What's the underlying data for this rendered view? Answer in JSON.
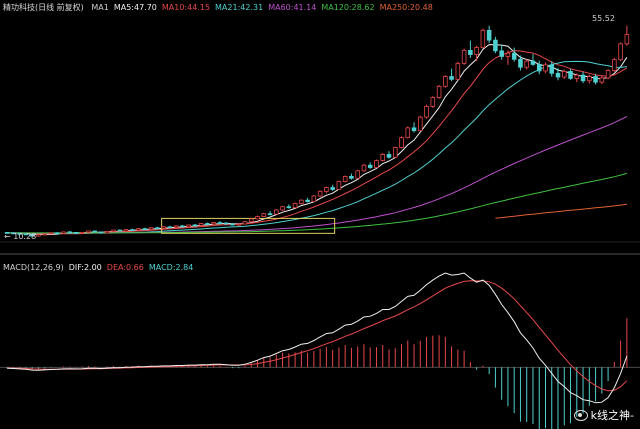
{
  "header": {
    "title": "精功科技(日线 前复权)",
    "ma_items": [
      {
        "label": "MA1",
        "value": "",
        "color": "#d0d0d0"
      },
      {
        "label": "MA5:",
        "value": "47.70",
        "color": "#f0f0f0"
      },
      {
        "label": "MA10:",
        "value": "44.15",
        "color": "#e84848"
      },
      {
        "label": "MA21:",
        "value": "42.31",
        "color": "#4fd0d0"
      },
      {
        "label": "MA60:",
        "value": "41.14",
        "color": "#c050d0"
      },
      {
        "label": "MA120:",
        "value": "28.62",
        "color": "#40c040"
      },
      {
        "label": "MA250:",
        "value": "20.48",
        "color": "#e06030"
      }
    ]
  },
  "macd_header": {
    "items": [
      {
        "label": "MACD(12,26,9)",
        "value": "",
        "color": "#d0d0d0"
      },
      {
        "label": "DIF:",
        "value": "2.00",
        "color": "#f0f0f0"
      },
      {
        "label": "DEA:",
        "value": "0.66",
        "color": "#e84848"
      },
      {
        "label": "MACD:",
        "value": "2.84",
        "color": "#4fd0d0"
      }
    ]
  },
  "labels": {
    "high_price": "55.52",
    "low_price": "10.28"
  },
  "watermark": "k线之神-",
  "colors": {
    "up": "#e84848",
    "down": "#4fd0d0",
    "ma5": "#f0f0f0",
    "ma10": "#e84848",
    "ma21": "#4fd0d0",
    "ma60": "#c050d0",
    "ma120": "#40c040",
    "ma250": "#e06030",
    "box": "#e0d060"
  },
  "chart_data": {
    "type": "candlestick",
    "price_range": [
      10,
      58
    ],
    "macd_range": [
      -2.6,
      4.8
    ],
    "grid": false,
    "candles": [
      [
        11.2,
        11.3,
        11.0,
        11.1
      ],
      [
        11.1,
        11.2,
        10.9,
        11.0
      ],
      [
        11.0,
        11.1,
        10.8,
        10.9
      ],
      [
        10.9,
        11.0,
        10.6,
        10.7
      ],
      [
        10.7,
        10.9,
        10.3,
        10.4
      ],
      [
        10.4,
        10.8,
        10.3,
        10.7
      ],
      [
        10.7,
        11.0,
        10.6,
        10.9
      ],
      [
        10.9,
        11.2,
        10.8,
        11.1
      ],
      [
        11.1,
        11.3,
        10.9,
        11.0
      ],
      [
        11.0,
        11.4,
        10.9,
        11.3
      ],
      [
        11.3,
        11.5,
        11.1,
        11.2
      ],
      [
        11.2,
        11.3,
        10.9,
        11.0
      ],
      [
        11.0,
        11.3,
        10.9,
        11.2
      ],
      [
        11.2,
        11.6,
        11.1,
        11.5
      ],
      [
        11.5,
        11.6,
        11.2,
        11.3
      ],
      [
        11.3,
        11.4,
        11.0,
        11.1
      ],
      [
        11.1,
        11.5,
        11.0,
        11.4
      ],
      [
        11.4,
        11.8,
        11.3,
        11.7
      ],
      [
        11.7,
        11.8,
        11.4,
        11.5
      ],
      [
        11.5,
        11.9,
        11.4,
        11.8
      ],
      [
        11.8,
        12.0,
        11.6,
        11.7
      ],
      [
        11.7,
        12.1,
        11.6,
        12.0
      ],
      [
        12.0,
        12.2,
        11.8,
        11.9
      ],
      [
        11.9,
        12.3,
        11.8,
        12.2
      ],
      [
        12.2,
        12.4,
        12.0,
        12.1
      ],
      [
        12.1,
        12.5,
        12.0,
        12.4
      ],
      [
        12.4,
        12.6,
        12.2,
        12.3
      ],
      [
        12.3,
        12.7,
        12.2,
        12.6
      ],
      [
        12.6,
        12.8,
        12.3,
        12.4
      ],
      [
        12.4,
        12.9,
        12.3,
        12.8
      ],
      [
        12.8,
        13.0,
        12.6,
        12.7
      ],
      [
        12.7,
        13.2,
        12.6,
        13.1
      ],
      [
        13.1,
        13.3,
        12.9,
        13.0
      ],
      [
        13.0,
        13.4,
        12.9,
        13.3
      ],
      [
        13.3,
        13.6,
        13.1,
        13.2
      ],
      [
        13.2,
        13.4,
        12.9,
        13.0
      ],
      [
        13.0,
        13.2,
        12.7,
        12.8
      ],
      [
        12.8,
        13.1,
        12.6,
        13.0
      ],
      [
        13.0,
        13.6,
        12.9,
        13.5
      ],
      [
        13.5,
        14.2,
        13.4,
        14.1
      ],
      [
        14.1,
        14.8,
        14.0,
        14.6
      ],
      [
        14.6,
        15.4,
        14.5,
        15.2
      ],
      [
        15.2,
        15.8,
        14.9,
        15.1
      ],
      [
        15.1,
        16.2,
        15.0,
        16.0
      ],
      [
        16.0,
        16.9,
        15.8,
        16.7
      ],
      [
        16.7,
        17.2,
        16.3,
        16.5
      ],
      [
        16.5,
        17.6,
        16.4,
        17.4
      ],
      [
        17.4,
        18.3,
        17.2,
        18.1
      ],
      [
        18.1,
        18.6,
        17.6,
        17.8
      ],
      [
        17.8,
        19.2,
        17.7,
        19.0
      ],
      [
        19.0,
        20.2,
        18.8,
        20.0
      ],
      [
        20.0,
        21.0,
        19.6,
        20.8
      ],
      [
        20.8,
        21.4,
        20.1,
        20.4
      ],
      [
        20.4,
        22.3,
        20.3,
        22.1
      ],
      [
        22.1,
        23.4,
        21.9,
        23.2
      ],
      [
        23.2,
        23.8,
        22.5,
        22.8
      ],
      [
        22.8,
        24.6,
        22.7,
        24.4
      ],
      [
        24.4,
        25.9,
        24.2,
        25.6
      ],
      [
        25.6,
        26.2,
        24.8,
        25.1
      ],
      [
        25.1,
        26.8,
        25.0,
        26.6
      ],
      [
        26.6,
        28.2,
        26.4,
        27.9
      ],
      [
        27.9,
        28.6,
        27.0,
        27.3
      ],
      [
        27.3,
        29.6,
        27.2,
        29.4
      ],
      [
        29.4,
        31.8,
        29.2,
        31.5
      ],
      [
        31.5,
        33.9,
        31.3,
        33.6
      ],
      [
        33.6,
        34.8,
        32.6,
        33.0
      ],
      [
        33.0,
        36.2,
        32.9,
        35.9
      ],
      [
        35.9,
        38.6,
        35.6,
        38.2
      ],
      [
        38.2,
        40.4,
        37.9,
        40.1
      ],
      [
        40.1,
        42.8,
        39.8,
        42.5
      ],
      [
        42.5,
        44.9,
        42.2,
        44.6
      ],
      [
        44.6,
        46.3,
        43.6,
        44.0
      ],
      [
        44.0,
        47.8,
        43.8,
        47.4
      ],
      [
        47.4,
        50.6,
        47.1,
        50.2
      ],
      [
        50.2,
        52.3,
        48.6,
        49.3
      ],
      [
        49.3,
        51.2,
        47.9,
        50.8
      ],
      [
        50.8,
        54.9,
        50.6,
        54.5
      ],
      [
        54.5,
        55.5,
        51.8,
        52.4
      ],
      [
        52.4,
        53.1,
        49.6,
        50.1
      ],
      [
        50.1,
        51.4,
        48.2,
        48.9
      ],
      [
        48.9,
        50.2,
        47.1,
        49.6
      ],
      [
        49.6,
        50.8,
        47.8,
        48.3
      ],
      [
        48.3,
        49.1,
        45.9,
        46.6
      ],
      [
        46.6,
        48.3,
        46.1,
        47.9
      ],
      [
        47.9,
        49.4,
        46.9,
        47.2
      ],
      [
        47.2,
        48.0,
        45.1,
        45.8
      ],
      [
        45.8,
        47.6,
        45.3,
        47.1
      ],
      [
        47.1,
        47.9,
        44.6,
        45.3
      ],
      [
        45.3,
        46.4,
        43.8,
        44.5
      ],
      [
        44.5,
        46.1,
        44.1,
        45.7
      ],
      [
        45.7,
        46.3,
        43.9,
        44.2
      ],
      [
        44.2,
        45.3,
        43.4,
        44.9
      ],
      [
        44.9,
        45.6,
        43.2,
        43.7
      ],
      [
        43.7,
        45.0,
        43.1,
        44.6
      ],
      [
        44.6,
        45.2,
        42.9,
        43.4
      ],
      [
        43.4,
        44.8,
        43.0,
        44.3
      ],
      [
        44.3,
        46.2,
        44.0,
        45.9
      ],
      [
        45.9,
        48.6,
        45.6,
        48.2
      ],
      [
        48.2,
        51.9,
        47.9,
        51.6
      ],
      [
        51.6,
        55.5,
        51.2,
        53.6
      ]
    ],
    "dif": [
      -0.05,
      -0.06,
      -0.08,
      -0.1,
      -0.14,
      -0.15,
      -0.13,
      -0.11,
      -0.1,
      -0.08,
      -0.07,
      -0.08,
      -0.07,
      -0.05,
      -0.05,
      -0.06,
      -0.04,
      -0.02,
      -0.02,
      0.0,
      0.01,
      0.03,
      0.03,
      0.05,
      0.05,
      0.07,
      0.07,
      0.09,
      0.09,
      0.11,
      0.11,
      0.13,
      0.13,
      0.15,
      0.15,
      0.13,
      0.1,
      0.1,
      0.15,
      0.24,
      0.35,
      0.48,
      0.55,
      0.68,
      0.82,
      0.88,
      1.0,
      1.14,
      1.18,
      1.32,
      1.5,
      1.66,
      1.7,
      1.88,
      2.08,
      2.12,
      2.28,
      2.48,
      2.52,
      2.66,
      2.85,
      2.85,
      3.0,
      3.25,
      3.5,
      3.55,
      3.8,
      4.08,
      4.3,
      4.5,
      4.65,
      4.55,
      4.58,
      4.65,
      4.4,
      4.2,
      4.3,
      4.05,
      3.6,
      3.1,
      2.7,
      2.25,
      1.7,
      1.35,
      0.95,
      0.45,
      0.1,
      -0.3,
      -0.7,
      -0.95,
      -1.25,
      -1.4,
      -1.6,
      -1.65,
      -1.75,
      -1.72,
      -1.5,
      -1.0,
      -0.3,
      0.55
    ],
    "dea": [
      -0.03,
      -0.04,
      -0.05,
      -0.06,
      -0.08,
      -0.09,
      -0.1,
      -0.1,
      -0.1,
      -0.1,
      -0.09,
      -0.09,
      -0.09,
      -0.08,
      -0.07,
      -0.07,
      -0.06,
      -0.05,
      -0.04,
      -0.03,
      -0.02,
      -0.01,
      0.0,
      0.01,
      0.02,
      0.03,
      0.04,
      0.05,
      0.06,
      0.07,
      0.08,
      0.09,
      0.1,
      0.11,
      0.12,
      0.12,
      0.12,
      0.12,
      0.12,
      0.14,
      0.18,
      0.24,
      0.3,
      0.37,
      0.46,
      0.54,
      0.63,
      0.73,
      0.82,
      0.92,
      1.04,
      1.16,
      1.27,
      1.39,
      1.53,
      1.64,
      1.77,
      1.91,
      2.03,
      2.16,
      2.3,
      2.41,
      2.53,
      2.68,
      2.84,
      2.98,
      3.14,
      3.33,
      3.52,
      3.71,
      3.9,
      4.03,
      4.14,
      4.24,
      4.27,
      4.26,
      4.26,
      4.22,
      4.1,
      3.9,
      3.66,
      3.38,
      3.04,
      2.7,
      2.35,
      1.97,
      1.6,
      1.22,
      0.84,
      0.48,
      0.13,
      -0.18,
      -0.46,
      -0.7,
      -0.91,
      -1.07,
      -1.16,
      -1.13,
      -0.96,
      -0.66
    ],
    "macd_series_names": [
      "DIF",
      "DEA",
      "MACD"
    ]
  }
}
